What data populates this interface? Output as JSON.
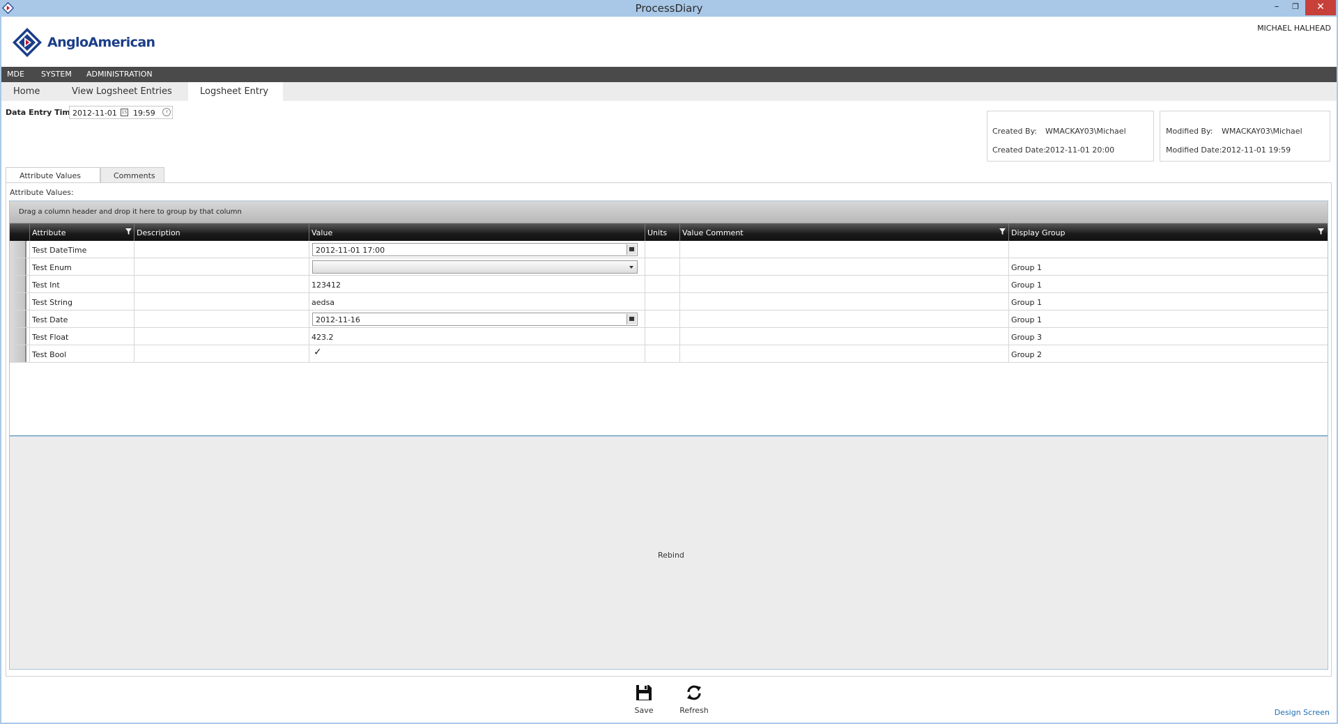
{
  "window": {
    "title": "ProcessDiary",
    "minimize": "–",
    "maximize": "❐",
    "close": "✕"
  },
  "header": {
    "logo_text": "AngloAmerican",
    "username": "MICHAEL HALHEAD"
  },
  "menu": {
    "items": [
      "MDE",
      "SYSTEM",
      "ADMINISTRATION"
    ]
  },
  "page_tabs": {
    "items": [
      "Home",
      "View Logsheet Entries",
      "Logsheet Entry"
    ],
    "active": "Logsheet Entry"
  },
  "data_entry": {
    "label": "Data Entry Time:",
    "date": "2012-11-01",
    "time": "19:59"
  },
  "created": {
    "by_label": "Created By:",
    "by_value": "WMACKAY03\\Michael",
    "date_label": "Created Date:",
    "date_value": "2012-11-01 20:00"
  },
  "modified": {
    "by_label": "Modified By:",
    "by_value": "WMACKAY03\\Michael",
    "date_label": "Modified Date:",
    "date_value": "2012-11-01 19:59"
  },
  "inner_tabs": {
    "items": [
      "Attribute Values",
      "Comments"
    ],
    "active": "Attribute Values"
  },
  "panel": {
    "label": "Attribute Values:"
  },
  "grid": {
    "group_hint": "Drag a column header and drop it here to group by that column",
    "columns": [
      "Attribute",
      "Description",
      "Value",
      "Units",
      "Value Comment",
      "Display Group"
    ],
    "rows": [
      {
        "attribute": "Test DateTime",
        "description": "",
        "value": "2012-11-01 17:00",
        "editor": "datetime",
        "units": "",
        "comment": "",
        "group": ""
      },
      {
        "attribute": "Test Enum",
        "description": "",
        "value": "",
        "editor": "dropdown",
        "units": "",
        "comment": "",
        "group": "Group 1"
      },
      {
        "attribute": "Test Int",
        "description": "",
        "value": "123412",
        "editor": "text",
        "units": "",
        "comment": "",
        "group": "Group 1"
      },
      {
        "attribute": "Test String",
        "description": "",
        "value": "aedsa",
        "editor": "text",
        "units": "",
        "comment": "",
        "group": "Group 1"
      },
      {
        "attribute": "Test Date",
        "description": "",
        "value": "2012-11-16",
        "editor": "datetime",
        "units": "",
        "comment": "",
        "group": "Group 1"
      },
      {
        "attribute": "Test Float",
        "description": "",
        "value": "423.2",
        "editor": "text",
        "units": "",
        "comment": "",
        "group": "Group 3"
      },
      {
        "attribute": "Test Bool",
        "description": "",
        "value": "✓",
        "editor": "check",
        "units": "",
        "comment": "",
        "group": "Group 2"
      }
    ],
    "rebind_label": "Rebind"
  },
  "toolbar": {
    "save_label": "Save",
    "refresh_label": "Refresh",
    "design_link": "Design Screen"
  },
  "icons": {
    "app": "anglo-american-logo-icon",
    "save": "floppy-disk-icon",
    "refresh": "refresh-arrows-icon",
    "filter": "funnel-filter-icon",
    "calendar": "calendar-icon",
    "clock": "clock-icon"
  },
  "colors": {
    "titlebar": "#a9c8e8",
    "menubar": "#4a4a4a",
    "brand_blue": "#1b3e88",
    "link_blue": "#1f6db5",
    "close_red": "#c7403a"
  }
}
